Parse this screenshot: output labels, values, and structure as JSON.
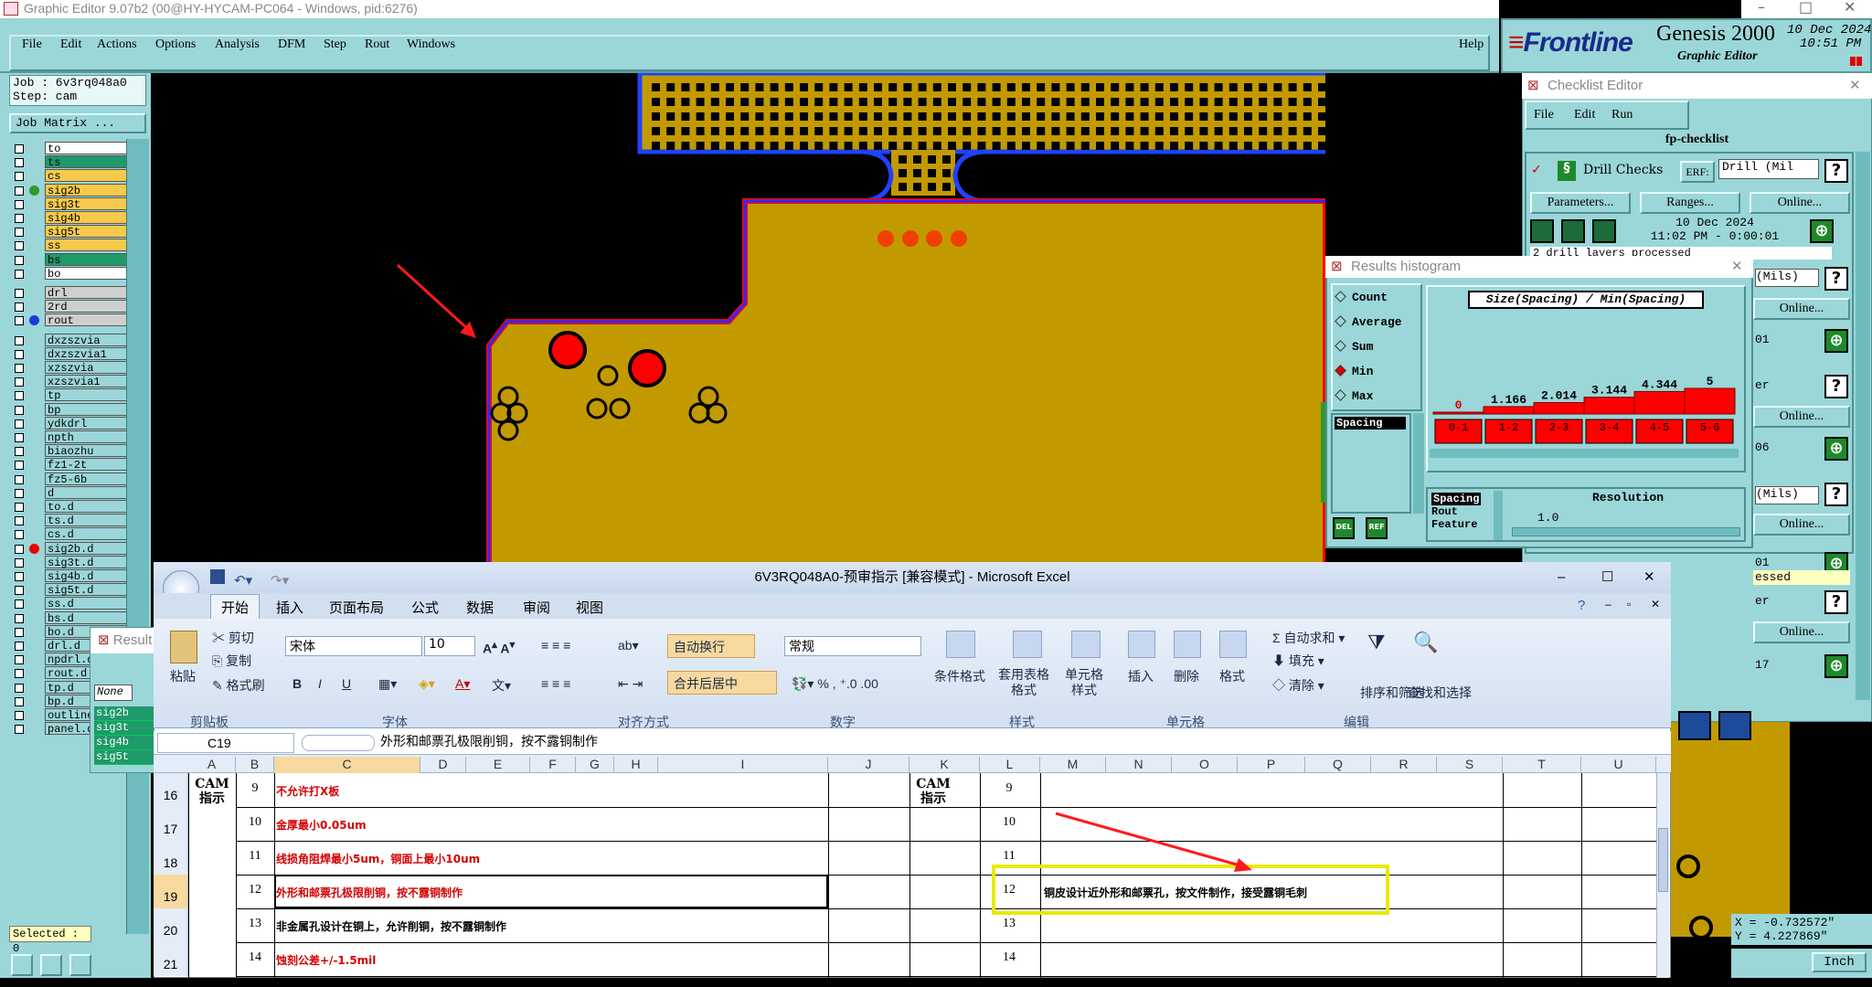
{
  "genesis": {
    "title": "Graphic Editor 9.07b2 (00@HY-HYCAM-PC064 - Windows, pid:6276)",
    "menu": [
      "File",
      "Edit",
      "Actions",
      "Options",
      "Analysis",
      "DFM",
      "Step",
      "Rout",
      "Windows"
    ],
    "help": "Help",
    "brand": "Frontline",
    "product": "Genesis 2000",
    "subtitle": "Graphic Editor",
    "date": "10 Dec 2024",
    "time": "10:51 PM",
    "job": "Job : 6v3rq048a0",
    "step": "Step: cam",
    "job_matrix": "Job Matrix ...",
    "layers": [
      "to",
      "ts",
      "cs",
      "sig2b",
      "sig3t",
      "sig4b",
      "sig5t",
      "ss",
      "bs",
      "bo",
      "drl",
      "2rd",
      "rout",
      "dxzszvia",
      "dxzszvia1",
      "xzszvia",
      "xzszvia1",
      "tp",
      "bp",
      "ydkdrl",
      "npth",
      "biaozhu",
      "fz1-2t",
      "fz5-6b",
      "d",
      "to.d",
      "ts.d",
      "cs.d",
      "sig2b.d",
      "sig3t.d",
      "sig4b.d",
      "sig5t.d",
      "ss.d",
      "bs.d",
      "bo.d",
      "drl.d",
      "npdrl.d",
      "rout.d",
      "tp.d",
      "bp.d",
      "outline",
      "panel.d"
    ],
    "selected": "Selected : 0",
    "coord_x": "X = -0.732572\"",
    "coord_y": "Y = 4.227869\"",
    "unit": "Inch",
    "none_label": "None",
    "results_label": "Result",
    "results_list": [
      "sig2b",
      "sig3t",
      "sig4b",
      "sig5t"
    ]
  },
  "checklist": {
    "title": "Checklist Editor",
    "menu": [
      "File",
      "Edit",
      "Run"
    ],
    "name": "fp-checklist",
    "drill_checks": "Drill Checks",
    "erf": "ERF:",
    "erf_value": "Drill (Mil",
    "params": "Parameters...",
    "ranges": "Ranges...",
    "online": "Online...",
    "run_date": "10 Dec 2024",
    "run_time": "11:02 PM - 0:00:01",
    "msg": "2 drill layers processed",
    "mils": "(Mils)",
    "cut_labels": [
      "01",
      "er",
      "06",
      "01",
      "essed",
      "er",
      "17"
    ]
  },
  "histogram": {
    "title": "Results histogram",
    "modes": [
      "Count",
      "Average",
      "Sum",
      "Min",
      "Max"
    ],
    "selected_mode": "Min",
    "list": [
      "Spacing"
    ],
    "chart_title": "Size(Spacing) / Min(Spacing)",
    "list2": [
      "Spacing",
      "Rout",
      "Feature"
    ],
    "resolution_label": "Resolution",
    "resolution": "1.0",
    "del": "DEL",
    "ref": "REF"
  },
  "chart_data": {
    "type": "bar",
    "title": "Size(Spacing) / Min(Spacing)",
    "categories": [
      "0-1",
      "1-2",
      "2-3",
      "3-4",
      "4-5",
      "5-6"
    ],
    "values": [
      0,
      1.166,
      2.014,
      3.144,
      4.344,
      5
    ],
    "value_labels": [
      "0",
      "1.166",
      "2.014",
      "3.144",
      "4.344",
      "5"
    ]
  },
  "excel": {
    "title": "6V3RQ048A0-预审指示 [兼容模式] - Microsoft Excel",
    "tabs": [
      "开始",
      "插入",
      "页面布局",
      "公式",
      "数据",
      "审阅",
      "视图"
    ],
    "clipboard": {
      "paste": "粘贴",
      "cut": "剪切",
      "copy": "复制",
      "painter": "格式刷",
      "group": "剪贴板"
    },
    "font": {
      "name": "宋体",
      "size": "10",
      "group": "字体"
    },
    "align": {
      "wrap": "自动换行",
      "merge": "合并后居中",
      "group": "对齐方式"
    },
    "number": {
      "format": "常规",
      "group": "数字"
    },
    "styles": {
      "cond": "条件格式",
      "table": "套用表格格式",
      "cell": "单元格样式",
      "group": "样式"
    },
    "cells": {
      "insert": "插入",
      "delete": "删除",
      "format": "格式",
      "group": "单元格"
    },
    "edit": {
      "sum": "自动求和",
      "fill": "填充",
      "clear": "清除",
      "sort": "排序和筛选",
      "find": "查找和选择",
      "group": "编辑"
    },
    "namebox": "C19",
    "formula": "外形和邮票孔极限削铜，按不露铜制作",
    "columns": [
      "A",
      "B",
      "C",
      "D",
      "E",
      "F",
      "G",
      "H",
      "I",
      "J",
      "K",
      "L",
      "M",
      "N",
      "O",
      "P",
      "Q",
      "R",
      "S",
      "T",
      "U"
    ],
    "rows": [
      "16",
      "17",
      "18",
      "19",
      "20",
      "21"
    ],
    "cam_label": "CAM\n指示",
    "left_rows": [
      {
        "n": "9",
        "text": "不允许打X板",
        "color": "#d40000"
      },
      {
        "n": "10",
        "text": "金厚最小0.05um",
        "color": "#d40000"
      },
      {
        "n": "11",
        "text": "线损角阻焊最小5um，铜面上最小10um",
        "color": "#d40000"
      },
      {
        "n": "12",
        "text": "外形和邮票孔极限削铜，按不露铜制作",
        "color": "#d40000"
      },
      {
        "n": "13",
        "text": "非金属孔设计在铜上，允许削铜，按不露铜制作",
        "color": "#000000"
      },
      {
        "n": "14",
        "text": "蚀刻公差+/-1.5mil",
        "color": "#d40000"
      }
    ],
    "right_rows": [
      {
        "n": "9",
        "text": ""
      },
      {
        "n": "10",
        "text": ""
      },
      {
        "n": "11",
        "text": ""
      },
      {
        "n": "12",
        "text": "铜皮设计近外形和邮票孔，按文件制作，接受露铜毛刺"
      },
      {
        "n": "13",
        "text": ""
      },
      {
        "n": "14",
        "text": ""
      }
    ]
  },
  "colors": {
    "teal": "#9bd6d8",
    "board": "#c29a00",
    "pad_red": "#ff0000",
    "grid_yellow": "#e8c200"
  }
}
